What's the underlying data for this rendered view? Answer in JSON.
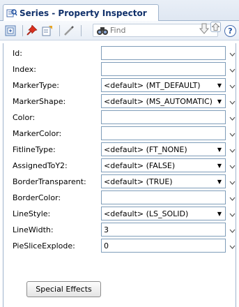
{
  "tab": {
    "title": "Series - Property Inspector",
    "icon": "property-inspector-icon"
  },
  "toolbar": {
    "buttons": [
      "target-icon",
      "pin-icon",
      "edit-icon",
      "pencil-icon"
    ],
    "search": {
      "placeholder": "Find",
      "value": ""
    },
    "nav": [
      "arrow-down-icon",
      "arrow-up-icon"
    ],
    "help_label": "?"
  },
  "colors": {
    "tab_title": "#10306a",
    "border": "#9fb3cc",
    "field_border": "#7f9db9"
  },
  "properties": [
    {
      "label": "Id:",
      "value": "",
      "dropdown": false
    },
    {
      "label": "Index:",
      "value": "",
      "dropdown": false
    },
    {
      "label": "MarkerType:",
      "value": "<default> (MT_DEFAULT)",
      "dropdown": true
    },
    {
      "label": "MarkerShape:",
      "value": "<default> (MS_AUTOMATIC)",
      "dropdown": true
    },
    {
      "label": "Color:",
      "value": "",
      "dropdown": false
    },
    {
      "label": "MarkerColor:",
      "value": "",
      "dropdown": false
    },
    {
      "label": "FitlineType:",
      "value": "<default> (FT_NONE)",
      "dropdown": true
    },
    {
      "label": "AssignedToY2:",
      "value": "<default> (FALSE)",
      "dropdown": true
    },
    {
      "label": "BorderTransparent:",
      "value": "<default> (TRUE)",
      "dropdown": true
    },
    {
      "label": "BorderColor:",
      "value": "",
      "dropdown": false
    },
    {
      "label": "LineStyle:",
      "value": "<default> (LS_SOLID)",
      "dropdown": true
    },
    {
      "label": "LineWidth:",
      "value": "3",
      "dropdown": false
    },
    {
      "label": "PieSliceExplode:",
      "value": "0",
      "dropdown": false
    }
  ],
  "special_effects_label": "Special Effects"
}
